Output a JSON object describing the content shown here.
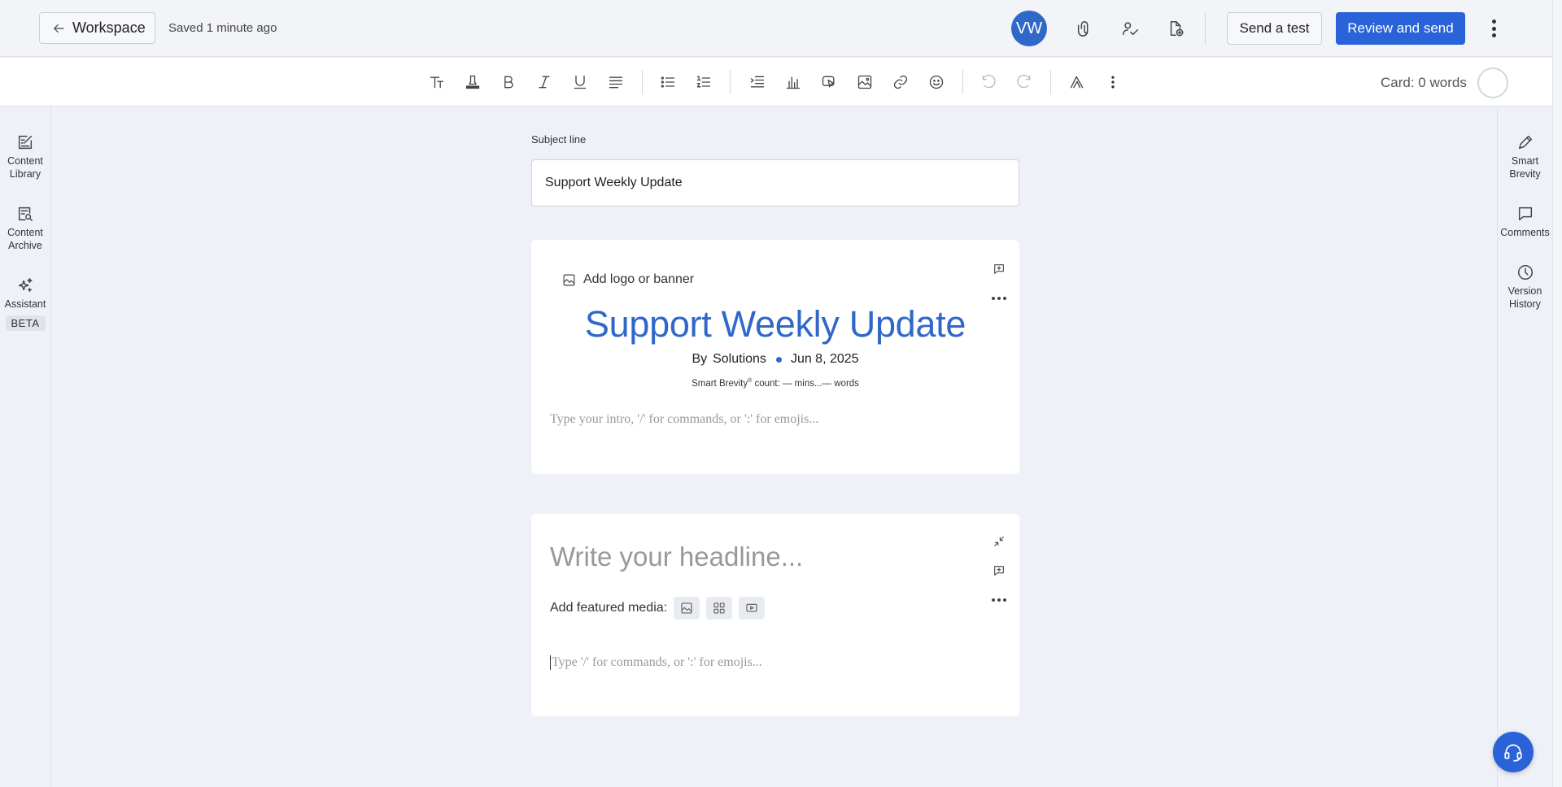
{
  "topbar": {
    "back_label": "Workspace",
    "saved_status": "Saved 1 minute ago",
    "avatar_initials": "VW",
    "send_test_label": "Send a test",
    "review_label": "Review and send"
  },
  "toolbar": {
    "card_words": "Card: 0 words"
  },
  "left_rail": {
    "items": [
      {
        "label": "Content\nLibrary",
        "icon": "edit-note-icon"
      },
      {
        "label": "Content\nArchive",
        "icon": "search-document-icon"
      },
      {
        "label": "Assistant",
        "icon": "sparkle-icon"
      }
    ],
    "beta_badge": "BETA"
  },
  "right_rail": {
    "items": [
      {
        "label": "Smart\nBrevity",
        "icon": "pen-icon"
      },
      {
        "label": "Comments",
        "icon": "comment-icon"
      },
      {
        "label": "Version\nHistory",
        "icon": "clock-icon"
      }
    ]
  },
  "subject": {
    "label": "Subject line",
    "value": "Support Weekly Update"
  },
  "header_card": {
    "add_logo_label": "Add logo or banner",
    "title": "Support Weekly Update",
    "by": "By",
    "author": "Solutions",
    "date": "Jun 8, 2025",
    "smart_brevity_prefix": "Smart Brevity",
    "smart_brevity_suffix": " count: — mins...— words",
    "intro_placeholder": "Type your intro, '/' for commands, or ':' for emojis..."
  },
  "story_card": {
    "headline_placeholder": "Write your headline...",
    "featured_media_label": "Add featured media:",
    "body_placeholder": "Type '/' for commands, or ':' for emojis..."
  },
  "colors": {
    "accent": "#2962d9",
    "title_blue": "#2f68c9",
    "background": "#eef1f7"
  }
}
